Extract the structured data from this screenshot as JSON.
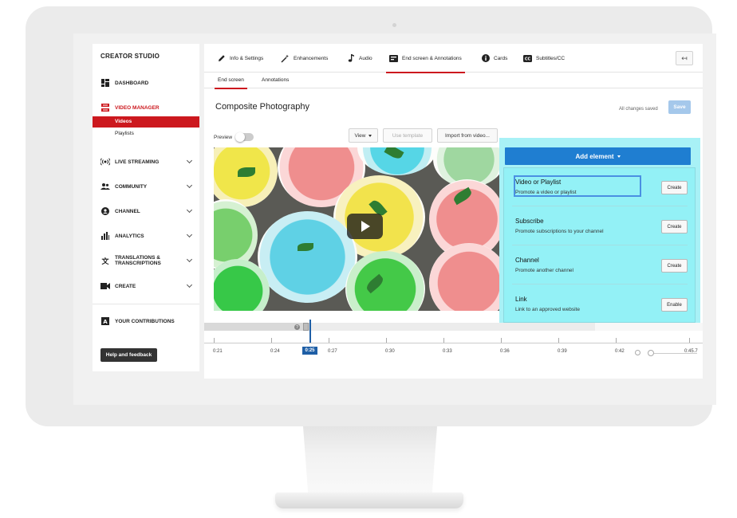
{
  "sidebar": {
    "title": "CREATOR STUDIO",
    "items": [
      {
        "label": "DASHBOARD"
      },
      {
        "label": "VIDEO MANAGER"
      },
      {
        "label": "LIVE STREAMING"
      },
      {
        "label": "COMMUNITY"
      },
      {
        "label": "CHANNEL"
      },
      {
        "label": "ANALYTICS"
      },
      {
        "label": "TRANSLATIONS & TRANSCRIPTIONS"
      },
      {
        "label": "CREATE"
      },
      {
        "label": "YOUR CONTRIBUTIONS"
      }
    ],
    "sub_items": [
      {
        "label": "Videos"
      },
      {
        "label": "Playlists"
      }
    ],
    "help_button": "Help and feedback"
  },
  "tabs": [
    {
      "label": "Info & Settings",
      "icon": "pencil-icon"
    },
    {
      "label": "Enhancements",
      "icon": "magic-wand-icon"
    },
    {
      "label": "Audio",
      "icon": "music-note-icon"
    },
    {
      "label": "End screen & Annotations",
      "icon": "end-screen-icon"
    },
    {
      "label": "Cards",
      "icon": "info-icon"
    },
    {
      "label": "Subtitles/CC",
      "icon": "cc-icon"
    }
  ],
  "subtabs": [
    {
      "label": "End screen"
    },
    {
      "label": "Annotations"
    }
  ],
  "video": {
    "title": "Composite Photography"
  },
  "status": {
    "saved": "All changes saved",
    "save_label": "Save"
  },
  "controls": {
    "preview_label": "Preview",
    "view_label": "View",
    "template_label": "Use template",
    "import_label": "Import from video..."
  },
  "add_element": {
    "label": "Add element",
    "items": [
      {
        "name": "Video or Playlist",
        "desc": "Promote a video or playlist",
        "action": "Create"
      },
      {
        "name": "Subscribe",
        "desc": "Promote subscriptions to your channel",
        "action": "Create"
      },
      {
        "name": "Channel",
        "desc": "Promote another channel",
        "action": "Create"
      },
      {
        "name": "Link",
        "desc": "Link to an approved website",
        "action": "Enable"
      }
    ]
  },
  "timeline": {
    "current": "0:25",
    "ticks": [
      "0:21",
      "0:24",
      "0:27",
      "0:30",
      "0:33",
      "0:36",
      "0:39",
      "0:42",
      "0:45.7"
    ]
  },
  "colors": {
    "accent_red": "#cc181e",
    "accent_blue": "#1f7ed1",
    "highlight": "#60e6ee"
  }
}
